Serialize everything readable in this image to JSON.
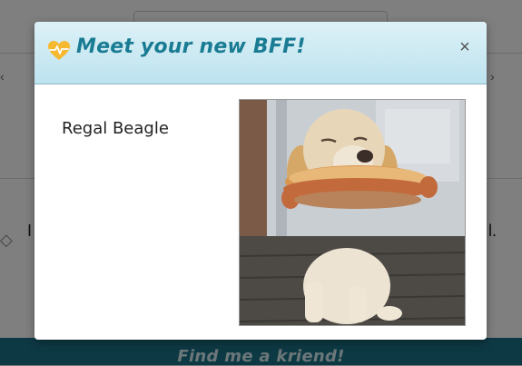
{
  "modal": {
    "title": "Meet your new BFF!",
    "close_label": "×",
    "dog_name": "Regal Beagle",
    "photo_alt": "Dog with a hot dog in its mouth"
  },
  "page": {
    "footer_button_label": "Find me a kriend!",
    "select_arrow": "⌄",
    "line_left": "I",
    "line_right": "l."
  },
  "icons": {
    "heart": "heart-pulse-icon",
    "close": "close-icon"
  },
  "colors": {
    "accent": "#1a7c93",
    "heart": "#f5b82e",
    "header_bg": "#cbe9f2",
    "footer_bg": "#1b7389"
  }
}
